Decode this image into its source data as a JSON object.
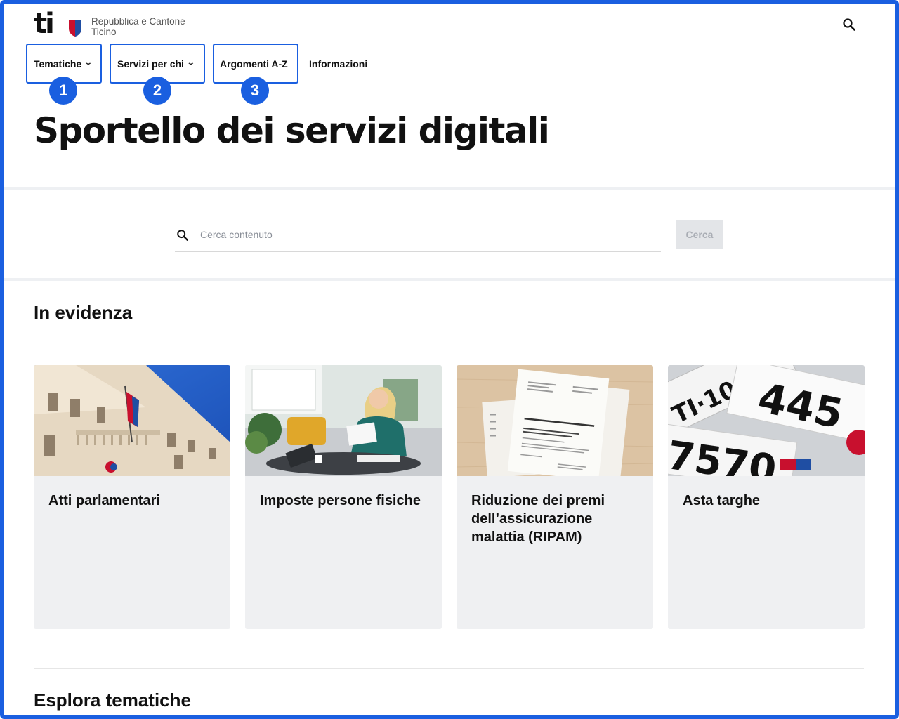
{
  "header": {
    "logo_mark": "ti",
    "org_line1": "Repubblica e Cantone",
    "org_line2": "Ticino",
    "search_icon": "search-icon"
  },
  "nav": {
    "items": [
      {
        "label": "Tematiche",
        "has_dropdown": true,
        "badge": "1"
      },
      {
        "label": "Servizi per chi",
        "has_dropdown": true,
        "badge": "2"
      },
      {
        "label": "Argomenti A-Z",
        "has_dropdown": false,
        "badge": "3"
      },
      {
        "label": "Informazioni",
        "has_dropdown": false
      }
    ]
  },
  "page": {
    "title": "Sportello dei servizi digitali"
  },
  "search": {
    "placeholder": "Cerca contenuto",
    "value": "",
    "button_label": "Cerca"
  },
  "highlights": {
    "title": "In evidenza",
    "cards": [
      {
        "title": "Atti parlamentari"
      },
      {
        "title": "Imposte persone fisiche"
      },
      {
        "title": "Riduzione dei premi dell’assicurazione malattia (RIPAM)"
      },
      {
        "title": "Asta targhe"
      }
    ]
  },
  "explore": {
    "title": "Esplora tematiche"
  },
  "colors": {
    "annotation_blue": "#1a5fe0",
    "card_bg": "#eff0f2",
    "band": "#eef0f3"
  }
}
